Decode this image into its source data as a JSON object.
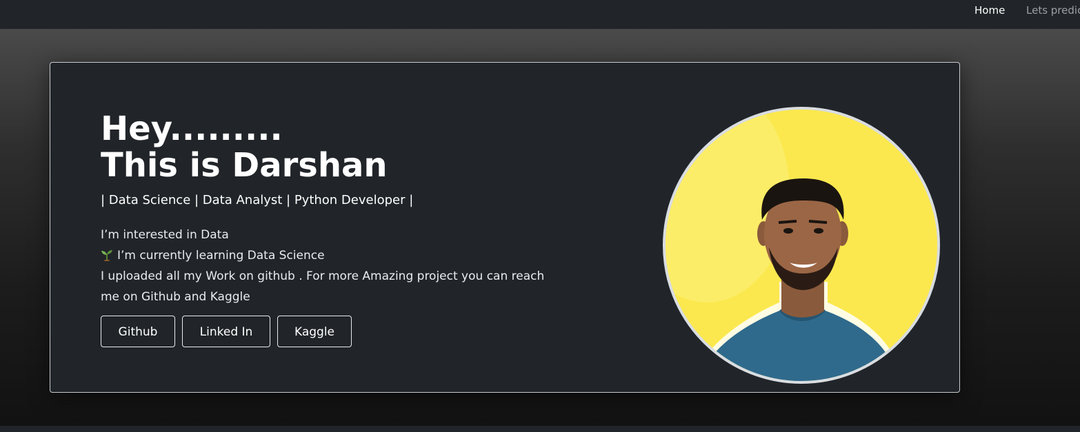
{
  "nav": {
    "items": [
      {
        "label": "Home"
      },
      {
        "label": "Lets predict"
      }
    ]
  },
  "hero": {
    "title_line1": "Hey.........",
    "title_line2": "This is Darshan",
    "roles": "| Data Science | Data Analyst | Python Developer |",
    "bio": {
      "line1": "I’m interested in Data",
      "line2_icon": "seedling-icon",
      "line2": "I’m currently learning Data Science",
      "line3": "I uploaded all my Work on github . For more Amazing project you can reach me on Github and Kaggle"
    },
    "buttons": [
      {
        "label": "Github"
      },
      {
        "label": "Linked In"
      },
      {
        "label": "Kaggle"
      }
    ]
  },
  "colors": {
    "card_bg": "#212529",
    "avatar_bg": "#fbe84e",
    "shirt": "#2f6a8c"
  }
}
